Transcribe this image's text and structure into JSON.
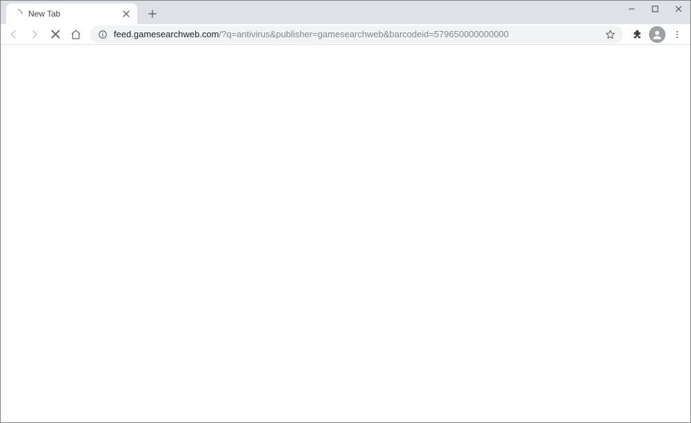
{
  "tab": {
    "title": "New Tab"
  },
  "url": {
    "domain": "feed.gamesearchweb.com",
    "path": "/?q=antivirus&publisher=gamesearchweb&barcodeid=579650000000000"
  },
  "icons": {
    "loading": "loading-spinner",
    "close_tab": "close",
    "new_tab": "plus",
    "minimize": "minimize",
    "maximize": "maximize",
    "close_window": "close",
    "back": "arrow-left",
    "forward": "arrow-right",
    "stop": "close",
    "home": "home",
    "site_info": "info",
    "bookmark": "star",
    "extensions": "puzzle",
    "profile": "person",
    "menu": "dots-vertical"
  }
}
